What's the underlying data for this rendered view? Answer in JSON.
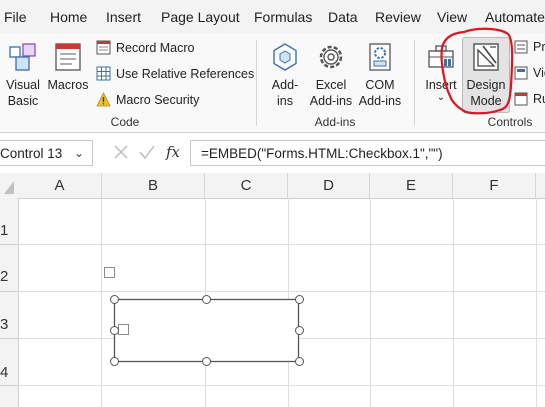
{
  "tabs": [
    "File",
    "Home",
    "Insert",
    "Page Layout",
    "Formulas",
    "Data",
    "Review",
    "View",
    "Automate"
  ],
  "ribbon": {
    "code_group": {
      "label": "Code",
      "visual_basic": "Visual\nBasic",
      "macros": "Macros",
      "record_macro": "Record Macro",
      "relative_refs": "Use Relative References",
      "macro_security": "Macro Security"
    },
    "addins_group": {
      "label": "Add-ins",
      "addins": "Add-\nins",
      "excel_addins": "Excel\nAdd-ins",
      "com_addins": "COM\nAdd-ins"
    },
    "controls_group": {
      "label": "Controls",
      "insert": "Insert",
      "design_mode": "Design\nMode",
      "properties": "Pro",
      "view_code": "Vie",
      "run_dialog": "Ru"
    }
  },
  "formula_bar": {
    "name_box": "Control 13",
    "formula": "=EMBED(\"Forms.HTML:Checkbox.1\",\"\")"
  },
  "columns": [
    "A",
    "B",
    "C",
    "D",
    "E",
    "F"
  ],
  "rows": [
    "1",
    "2",
    "3",
    "4"
  ],
  "colors": {
    "annotation": "#e0141e",
    "design_mode_active": "#e3e3e3",
    "ribbon_bg": "#f9f9f9"
  }
}
